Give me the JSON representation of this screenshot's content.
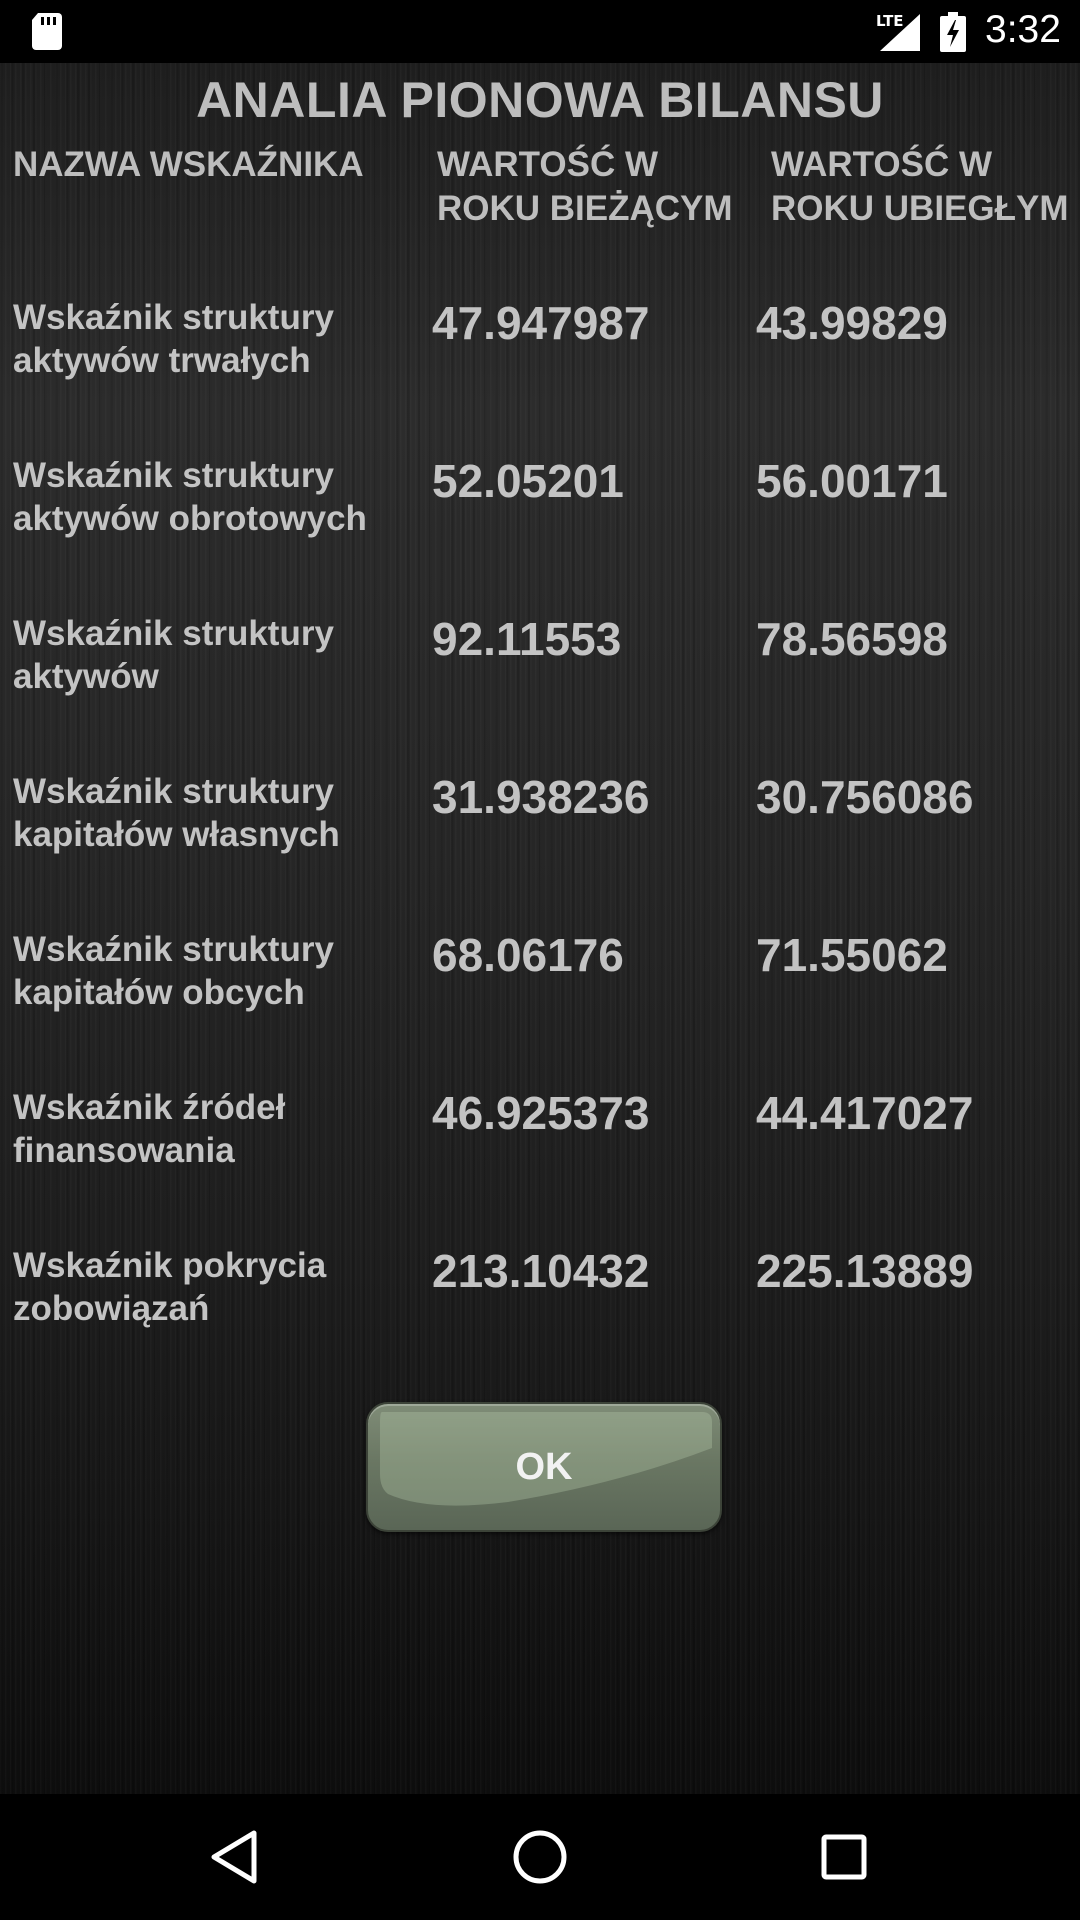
{
  "status_bar": {
    "network_label": "LTE",
    "time": "3:32",
    "icons": [
      "sd-card-icon",
      "signal-icon",
      "battery-charging-icon"
    ]
  },
  "screen": {
    "title": "ANALIA PIONOWA BILANSU",
    "headers": {
      "name": "NAZWA WSKAŹNIKA",
      "current_year": "WARTOŚĆ W ROKU BIEŻĄCYM",
      "previous_year": "WARTOŚĆ W ROKU UBIEGŁYM"
    },
    "rows": [
      {
        "name": "Wskaźnik struktury aktywów trwałych",
        "current": "47.947987",
        "previous": "43.99829"
      },
      {
        "name": "Wskaźnik struktury aktywów obrotowych",
        "current": "52.05201",
        "previous": "56.00171"
      },
      {
        "name": "Wskaźnik struktury aktywów",
        "current": "92.11553",
        "previous": "78.56598"
      },
      {
        "name": "Wskaźnik struktury kapitałów własnych",
        "current": "31.938236",
        "previous": "30.756086"
      },
      {
        "name": "Wskaźnik struktury kapitałów obcych",
        "current": "68.06176",
        "previous": "71.55062"
      },
      {
        "name": "Wskaźnik źródeł finansowania",
        "current": "46.925373",
        "previous": "44.417027"
      },
      {
        "name": "Wskaźnik pokrycia zobowiązań",
        "current": "213.10432",
        "previous": "225.13889"
      }
    ],
    "ok_button_label": "OK"
  },
  "nav_bar": {
    "buttons": [
      "back-icon",
      "home-icon",
      "recents-icon"
    ]
  },
  "colors": {
    "text": "#c3c3c3",
    "button": "#6a7763"
  }
}
